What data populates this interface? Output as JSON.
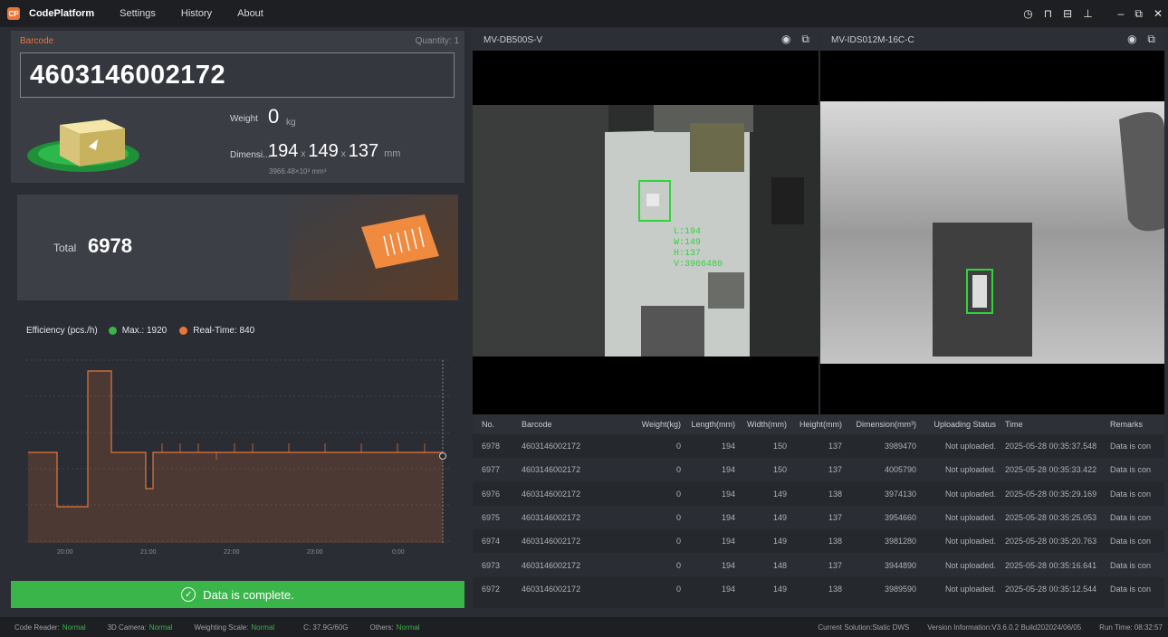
{
  "titlebar": {
    "app": "CodePlatform",
    "menu": [
      "Settings",
      "History",
      "About"
    ]
  },
  "barcode_card": {
    "label": "Barcode",
    "quantity": "Quantity: 1",
    "barcode": "4603146002172",
    "weight_label": "Weight",
    "weight": "0",
    "weight_unit": "kg",
    "dim_label": "Dimensi...",
    "length": "194",
    "width": "149",
    "height": "137",
    "dim_unit": "mm",
    "volume": "3966.48×10³ mm³"
  },
  "total": {
    "label": "Total",
    "value": "6978"
  },
  "efficiency": {
    "label": "Efficiency (pcs./h)",
    "max": "Max.: 1920",
    "realtime": "Real-Time: 840",
    "xticks": [
      "20:00",
      "21:00",
      "22:00",
      "23:00",
      "0:00"
    ]
  },
  "complete": "Data is complete.",
  "cameras": [
    {
      "name": "MV-DB500S-V",
      "overlay": [
        "L:194",
        "W:149",
        "H:137",
        "V:3966480"
      ]
    },
    {
      "name": "MV-IDS012M-16C-C"
    }
  ],
  "table": {
    "headers": [
      "No.",
      "Barcode",
      "Weight(kg)",
      "Length(mm)",
      "Width(mm)",
      "Height(mm)",
      "Dimension(mm³)",
      "Uploading Status",
      "Time",
      "Remarks"
    ],
    "rows": [
      [
        "6978",
        "4603146002172",
        "0",
        "194",
        "150",
        "137",
        "3989470",
        "Not uploaded.",
        "2025-05-28 00:35:37.548",
        "Data is con"
      ],
      [
        "6977",
        "4603146002172",
        "0",
        "194",
        "150",
        "137",
        "4005790",
        "Not uploaded.",
        "2025-05-28 00:35:33.422",
        "Data is con"
      ],
      [
        "6976",
        "4603146002172",
        "0",
        "194",
        "149",
        "138",
        "3974130",
        "Not uploaded.",
        "2025-05-28 00:35:29.169",
        "Data is con"
      ],
      [
        "6975",
        "4603146002172",
        "0",
        "194",
        "149",
        "137",
        "3954660",
        "Not uploaded.",
        "2025-05-28 00:35:25.053",
        "Data is con"
      ],
      [
        "6974",
        "4603146002172",
        "0",
        "194",
        "149",
        "138",
        "3981280",
        "Not uploaded.",
        "2025-05-28 00:35:20.763",
        "Data is con"
      ],
      [
        "6973",
        "4603146002172",
        "0",
        "194",
        "148",
        "137",
        "3944890",
        "Not uploaded.",
        "2025-05-28 00:35:16.641",
        "Data is con"
      ],
      [
        "6972",
        "4603146002172",
        "0",
        "194",
        "149",
        "138",
        "3989590",
        "Not uploaded.",
        "2025-05-28 00:35:12.544",
        "Data is con"
      ]
    ]
  },
  "statusbar": {
    "code_reader": "Code Reader:",
    "code_reader_v": "Normal",
    "camera3d": "3D Camera:",
    "camera3d_v": "Normal",
    "scale": "Weighting Scale:",
    "scale_v": "Normal",
    "disk": "C: 37.9G/60G",
    "others": "Others:",
    "others_v": "Normal",
    "solution": "Current Solution:Static DWS",
    "version": "Version Information:V3.6.0.2 Build202024/06/05",
    "runtime": "Run Time: 08:32:57"
  },
  "colors": {
    "accent": "#e8763a",
    "ok": "#3ab54a"
  }
}
